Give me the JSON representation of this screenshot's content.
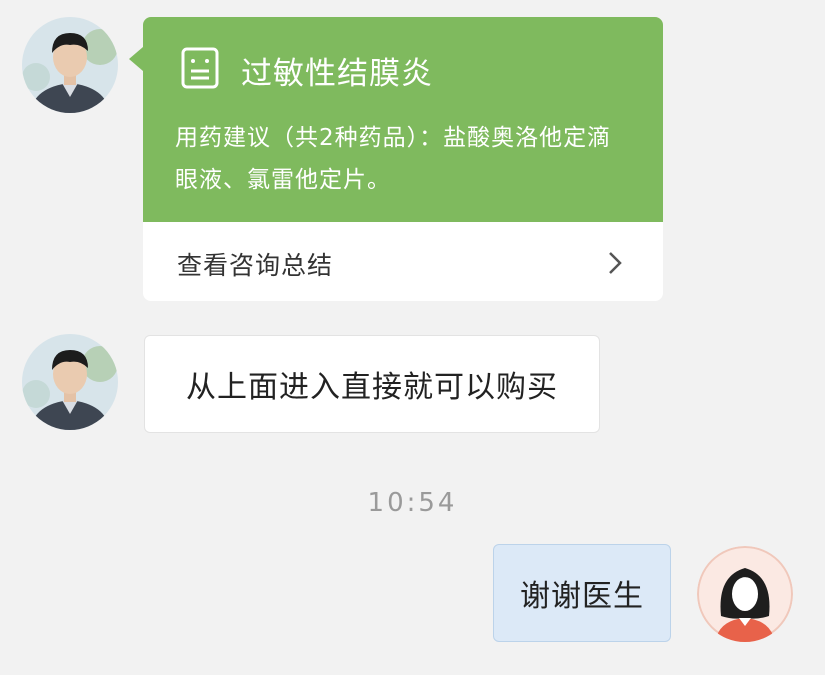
{
  "card": {
    "title": "过敏性结膜炎",
    "description": "用药建议（共2种药品）：盐酸奥洛他定滴眼液、氯雷他定片。",
    "link_label": "查看咨询总结",
    "accent_color": "#7fba5e",
    "icon": "summary-document-icon"
  },
  "messages": {
    "doctor_text": "从上面进入直接就可以购买",
    "timestamp": "10:54",
    "user_text": "谢谢医生"
  }
}
